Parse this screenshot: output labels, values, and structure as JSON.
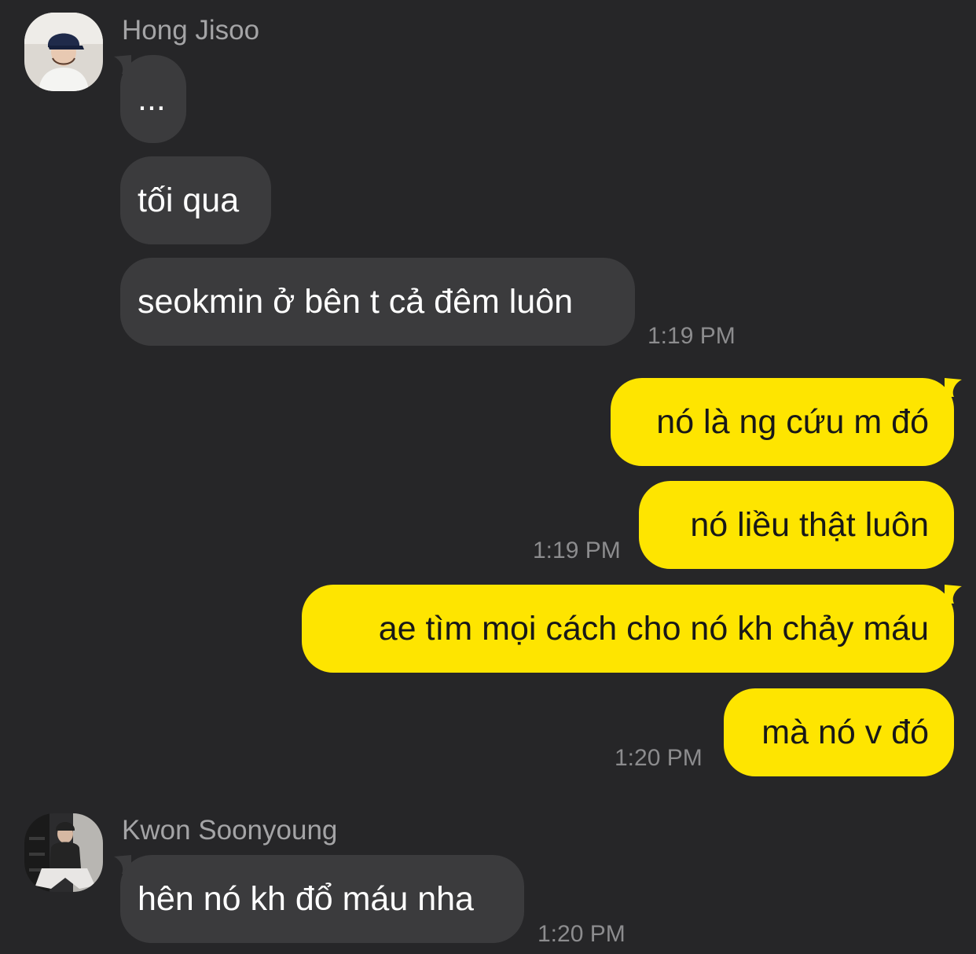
{
  "colors": {
    "background": "#262628",
    "incoming_bubble": "#3b3b3d",
    "outgoing_bubble": "#fee500",
    "incoming_text": "#ffffff",
    "outgoing_text": "#181818",
    "sender_name": "#a4a4a6",
    "timestamp": "#8c8c8e"
  },
  "senders": {
    "hong": {
      "name": "Hong Jisoo",
      "avatar_icon": "profile-photo-icon"
    },
    "kwon": {
      "name": "Kwon Soonyoung",
      "avatar_icon": "profile-photo-icon"
    }
  },
  "messages": [
    {
      "sender": "hong",
      "direction": "in",
      "text": "..."
    },
    {
      "sender": "hong",
      "direction": "in",
      "text": "tối qua"
    },
    {
      "sender": "hong",
      "direction": "in",
      "text": "seokmin ở bên t cả đêm luôn",
      "time": "1:19 PM"
    },
    {
      "sender": "me",
      "direction": "out",
      "text": "nó là ng cứu m đó"
    },
    {
      "sender": "me",
      "direction": "out",
      "text": "nó liều thật luôn",
      "time": "1:19 PM"
    },
    {
      "sender": "me",
      "direction": "out",
      "text": "ae tìm mọi cách cho nó kh chảy máu"
    },
    {
      "sender": "me",
      "direction": "out",
      "text": "mà nó v đó",
      "time": "1:20 PM"
    },
    {
      "sender": "kwon",
      "direction": "in",
      "text": "hên nó kh đổ máu nha",
      "time": "1:20 PM"
    }
  ]
}
